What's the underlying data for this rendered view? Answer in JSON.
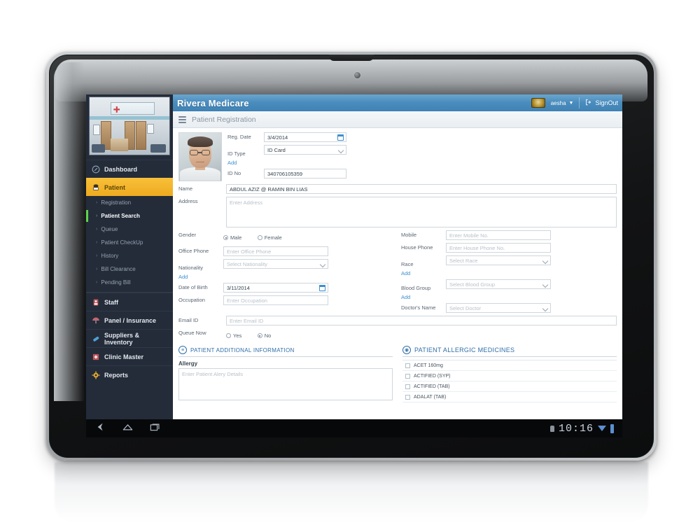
{
  "app": {
    "brand": "Rivera Medicare",
    "page_title": "Patient Registration",
    "user_name": "aesha",
    "signout_label": "SignOut",
    "menu_icon": "hamburger-icon",
    "user_chevron": "chevron-down-icon",
    "signout_icon": "signout-icon",
    "logo_icon": "clinic-logo-badge",
    "accent_blue": "#4a8cbd",
    "accent_amber": "#f0b429",
    "sidebar_bg": "#242c3a",
    "link_blue": "#3d8fd0"
  },
  "sidebar": {
    "photo_alt": "clinic-interior-photo",
    "items": [
      {
        "label": "Dashboard",
        "icon": "dashboard-icon",
        "active": false
      },
      {
        "label": "Patient",
        "icon": "patient-icon",
        "active": true
      },
      {
        "label": "Staff",
        "icon": "staff-icon",
        "active": false
      },
      {
        "label": "Panel / Insurance",
        "icon": "umbrella-icon",
        "active": false
      },
      {
        "label": "Suppliers & Inventory",
        "icon": "pill-icon",
        "active": false
      },
      {
        "label": "Clinic Master",
        "icon": "clinic-icon",
        "active": false
      },
      {
        "label": "Reports",
        "icon": "gear-icon",
        "active": false
      }
    ],
    "sub_items": [
      {
        "label": "Registration",
        "selected": false
      },
      {
        "label": "Patient Search",
        "selected": true
      },
      {
        "label": "Queue",
        "selected": false
      },
      {
        "label": "Patient CheckUp",
        "selected": false
      },
      {
        "label": "History",
        "selected": false
      },
      {
        "label": "Bill Clearance",
        "selected": false
      },
      {
        "label": "Pending Bill",
        "selected": false
      }
    ]
  },
  "form": {
    "patient_photo_alt": "patient-portrait",
    "reg_date": {
      "label": "Reg. Date",
      "value": "3/4/2014",
      "icon": "calendar-icon"
    },
    "id_type": {
      "label": "ID Type",
      "value": "ID Card",
      "add_label": "Add",
      "icon": "chevron-down-icon"
    },
    "id_no": {
      "label": "ID No",
      "value": "340706105359"
    },
    "name": {
      "label": "Name",
      "value": "ABDUL AZIZ @ RAMIN BIN LIAS"
    },
    "address": {
      "label": "Address",
      "value": "",
      "placeholder": "Enter Address"
    },
    "gender": {
      "label": "Gender",
      "options": [
        "Male",
        "Female"
      ],
      "selected": "Male"
    },
    "office_phone": {
      "label": "Office Phone",
      "value": "",
      "placeholder": "Enter Office Phone"
    },
    "nationality": {
      "label": "Nationality",
      "value": "",
      "placeholder": "Select Nationality",
      "add_label": "Add"
    },
    "date_of_birth": {
      "label": "Date of Birth",
      "value": "3/11/2014",
      "icon": "calendar-icon"
    },
    "occupation": {
      "label": "Occupation",
      "value": "",
      "placeholder": "Enter Occupation"
    },
    "email_id": {
      "label": "Email ID",
      "value": "",
      "placeholder": "Enter Email ID"
    },
    "queue_now": {
      "label": "Queue Now",
      "options": [
        "Yes",
        "No"
      ],
      "selected": "No"
    },
    "mobile": {
      "label": "Mobile",
      "value": "",
      "placeholder": "Enter Mobile No."
    },
    "house_phone": {
      "label": "House Phone",
      "value": "",
      "placeholder": "Enter House Phone No."
    },
    "race": {
      "label": "Race",
      "value": "",
      "placeholder": "Select Race",
      "add_label": "Add"
    },
    "blood_group": {
      "label": "Blood Group",
      "value": "",
      "placeholder": "Select Blood Group",
      "add_label": "Add"
    },
    "doctors_name": {
      "label": "Doctor's Name",
      "value": "",
      "placeholder": "Select Doctor"
    }
  },
  "panels": {
    "additional_info": {
      "title": "PATIENT ADDITIONAL INFORMATION",
      "icon": "list-icon",
      "allergy_label": "Allergy",
      "allergy_placeholder": "Enter Patient Alery Details"
    },
    "allergic_medicines": {
      "title": "PATIENT ALLERGIC MEDICINES",
      "icon": "camera-icon",
      "items": [
        {
          "name": "ACET 160mg",
          "checked": false
        },
        {
          "name": "ACTIFIED (SYP)",
          "checked": false
        },
        {
          "name": "ACTIFIED (TAB)",
          "checked": false
        },
        {
          "name": "ADALAT (TAB)",
          "checked": false
        }
      ]
    }
  },
  "device": {
    "nav_back_icon": "back-icon",
    "nav_home_icon": "home-icon",
    "nav_recents_icon": "recents-icon",
    "clock": "10:16",
    "usb_icon": "usb-icon",
    "wifi_icon": "wifi-icon",
    "battery_icon": "battery-icon"
  }
}
